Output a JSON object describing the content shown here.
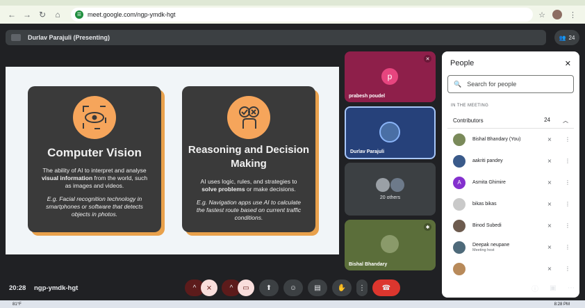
{
  "browser": {
    "url": "meet.google.com/ngp-ymdk-hgt"
  },
  "meet": {
    "presenter_label": "Durlav Parajuli (Presenting)",
    "participant_count": "24",
    "meeting_time": "20:28",
    "meeting_code": "ngp-ymdk-hgt"
  },
  "slide": {
    "cards": [
      {
        "title": "Computer Vision",
        "desc_a": "The ability of AI to interpret and analyse ",
        "desc_bold": "visual information",
        "desc_b": " from the world, such as images and videos.",
        "example": "E.g. Facial recognition technology in smartphones or software that detects objects in photos."
      },
      {
        "title": "Reasoning and Decision Making",
        "desc_a": "AI uses logic, rules, and strategies to ",
        "desc_bold": "solve problems",
        "desc_b": " or make decisions.",
        "example": "E.g. Navigation apps use AI to calculate the fastest route based on current traffic conditions."
      }
    ]
  },
  "tiles": [
    {
      "name": "prabesh poudel",
      "initial": "p",
      "bg": "#8e1f4a",
      "avatar_bg": "#e7457f"
    },
    {
      "name": "Durlav Parajuli",
      "bg": "#26417a"
    },
    {
      "name": "20 others",
      "bg": "#3c4043"
    },
    {
      "name": "Bishal Bhandary",
      "bg": "#5b6e3a"
    }
  ],
  "people": {
    "title": "People",
    "search_placeholder": "Search for people",
    "section_label": "IN THE MEETING",
    "contributors_label": "Contributors",
    "contributors_count": "24",
    "list": [
      {
        "name": "Bishal Bhandary (You)",
        "color": "#7a8a5a"
      },
      {
        "name": "aakriti pandey",
        "color": "#3a5a8a"
      },
      {
        "name": "Asmita Ghimire",
        "initial": "A",
        "color": "#8430ce"
      },
      {
        "name": "bikas bikas",
        "color": "#c9c9c9"
      },
      {
        "name": "Binod Subedi",
        "color": "#6d5b4e"
      },
      {
        "name": "Deepak neupane",
        "sub": "Meeting host",
        "color": "#4e6a7a"
      },
      {
        "name": "",
        "color": "#b88a5a"
      }
    ]
  },
  "taskbar": {
    "temp": "81°F",
    "clock": "8:28 PM"
  }
}
